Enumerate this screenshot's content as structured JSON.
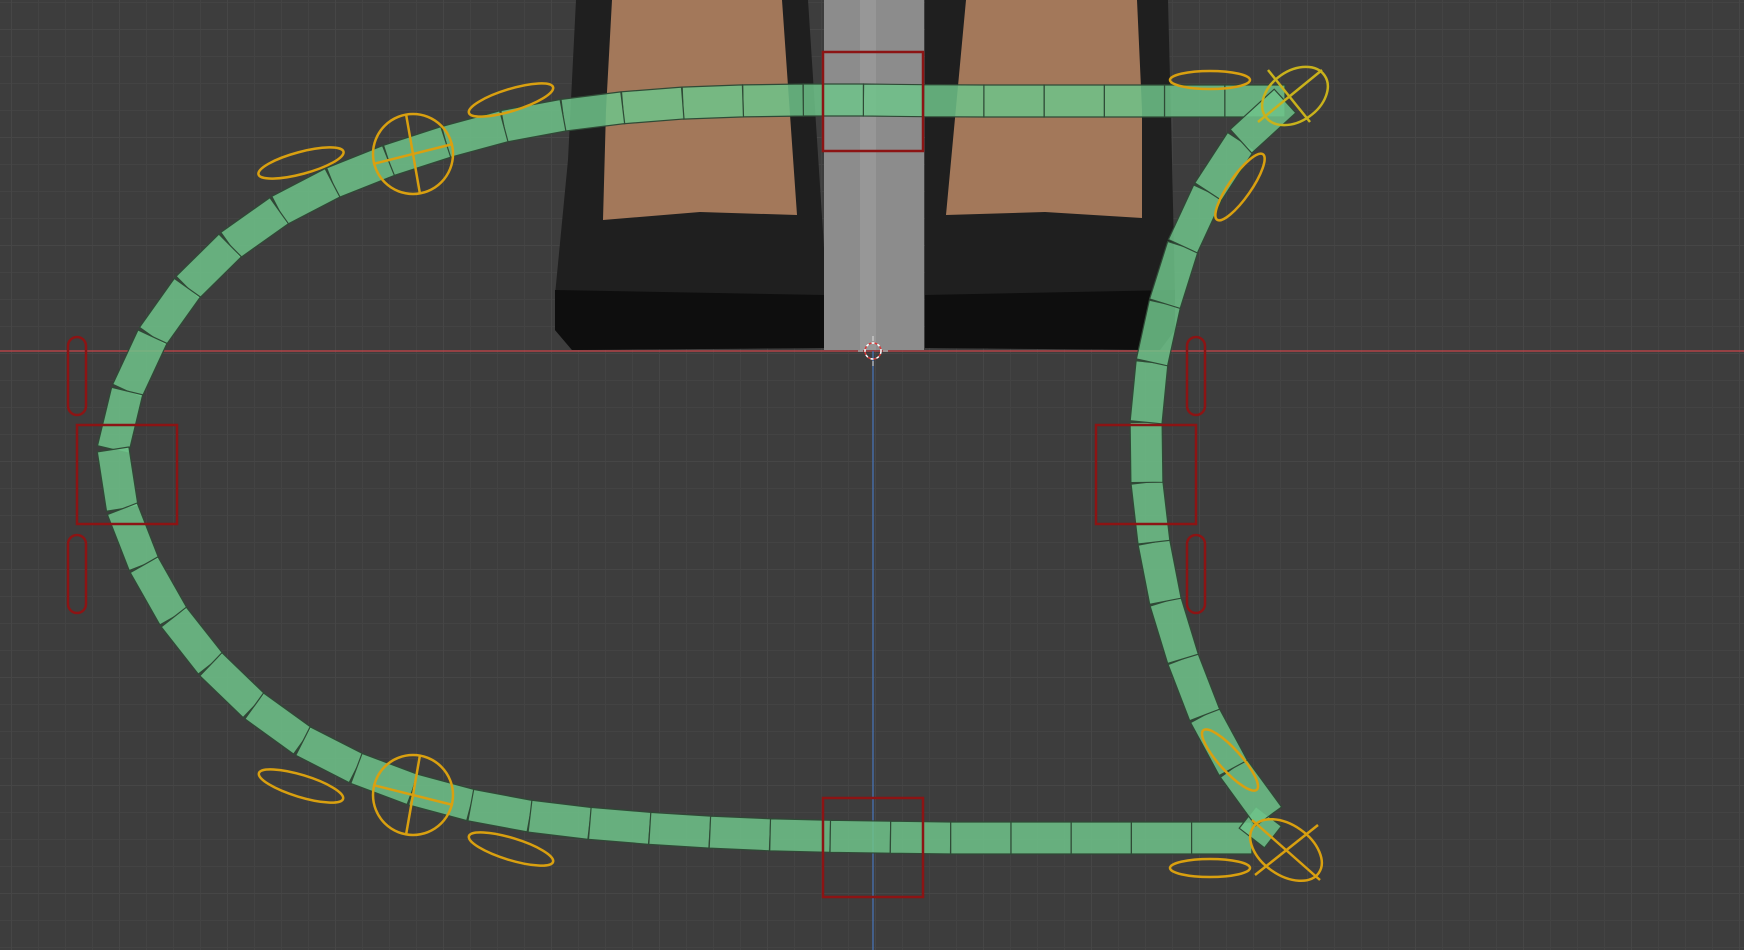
{
  "viewport": {
    "background": "#3d3d3d",
    "grid_color": "#464646",
    "x_axis_color": "#c8444a",
    "z_axis_color": "#4772b3"
  },
  "scene": {
    "character_shoes": {
      "color": "#1c1c1c",
      "skin_color": "#a3785a",
      "pole_color": "#8c8c8c"
    },
    "spline_rig": {
      "segment_color": "#6fc38a",
      "segment_count": 58
    },
    "controls": {
      "square_color": "#8c1414",
      "square_count": 4,
      "circle_color": "#d9a010",
      "circle_count": 4,
      "red_capsule_count": 4,
      "yellow_capsule_count": 8
    },
    "cursor_icon": "3d-cursor-icon"
  }
}
